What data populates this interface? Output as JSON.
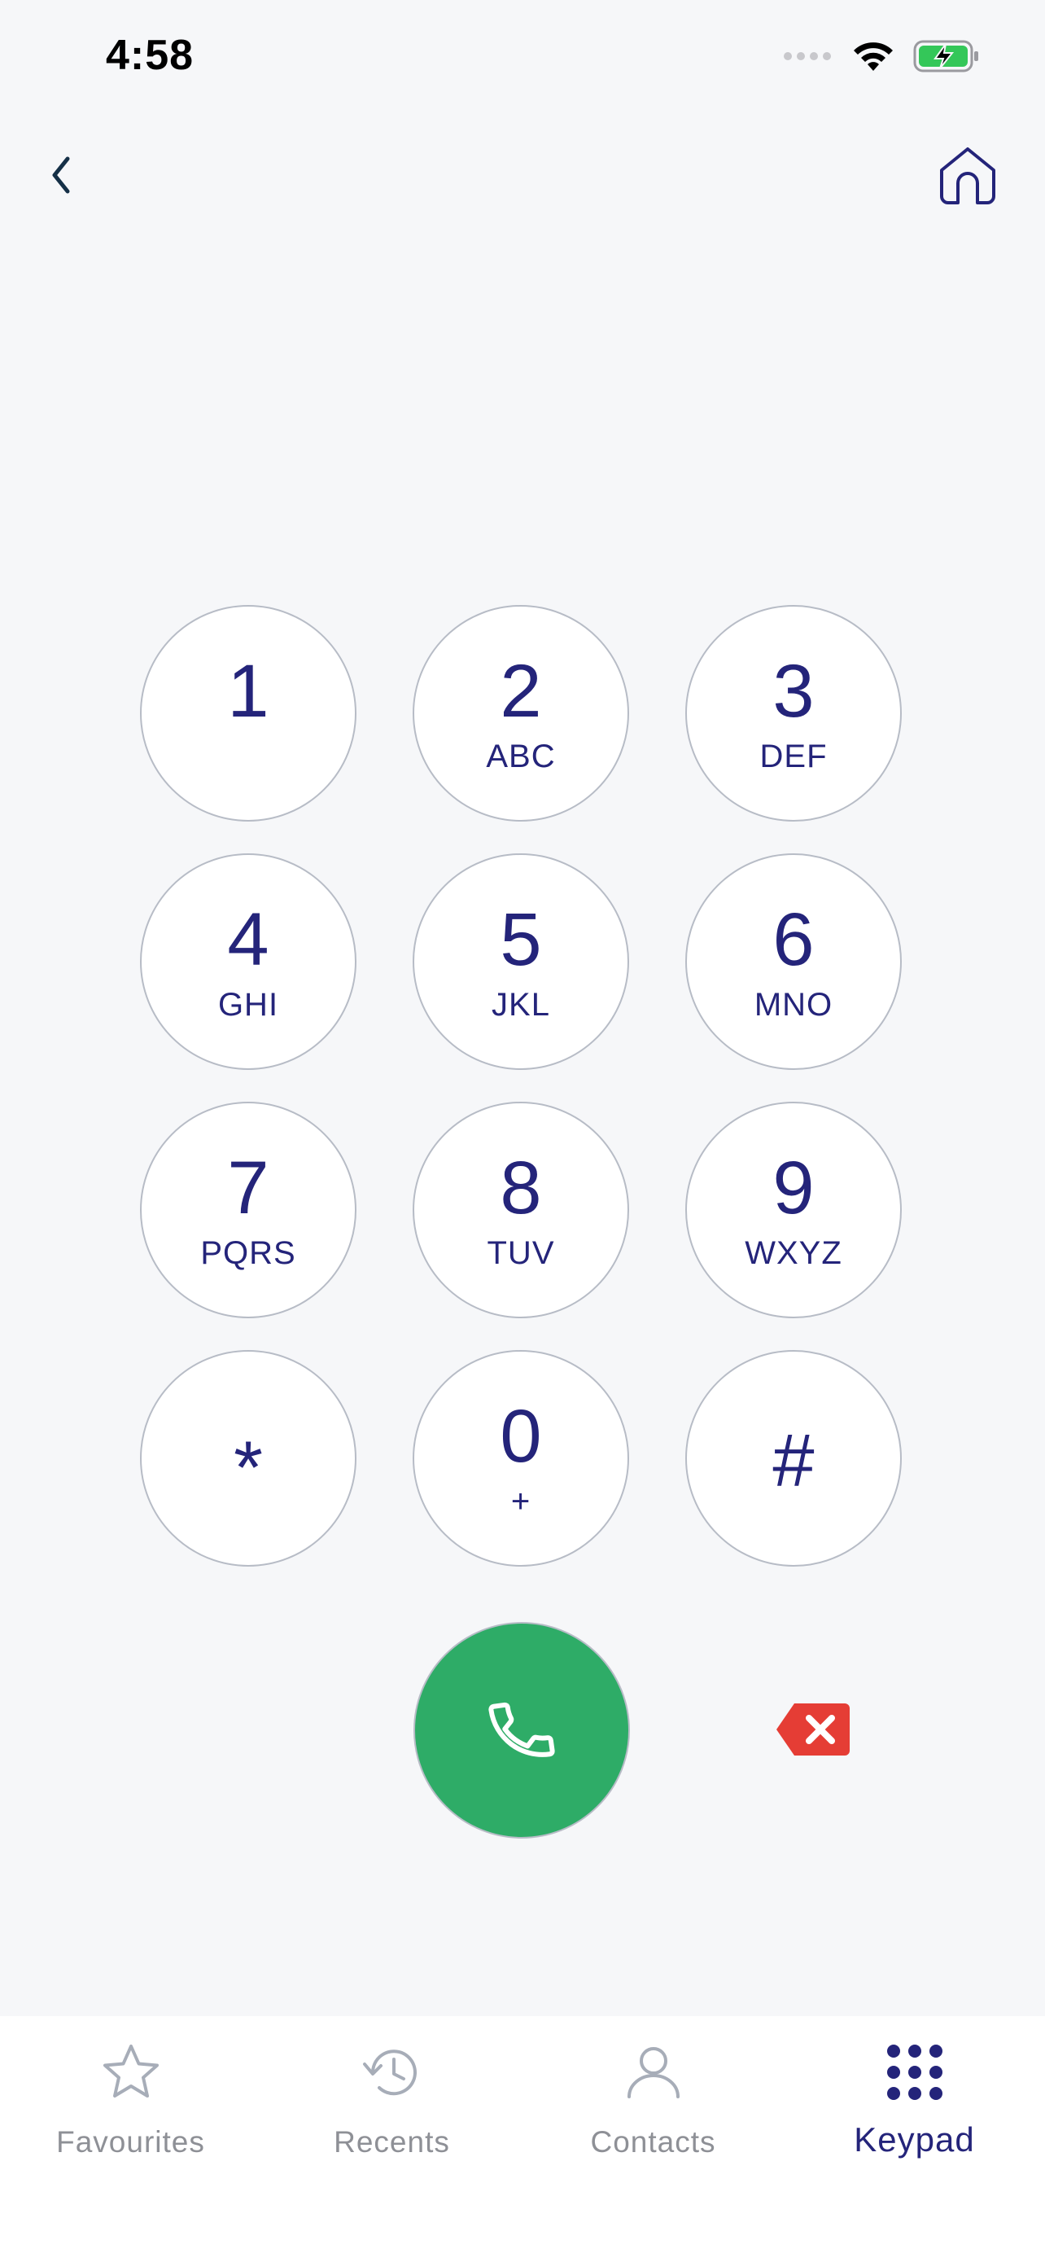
{
  "status_bar": {
    "time": "4:58"
  },
  "keypad": {
    "keys": [
      {
        "digit": "1",
        "letters": ""
      },
      {
        "digit": "2",
        "letters": "ABC"
      },
      {
        "digit": "3",
        "letters": "DEF"
      },
      {
        "digit": "4",
        "letters": "GHI"
      },
      {
        "digit": "5",
        "letters": "JKL"
      },
      {
        "digit": "6",
        "letters": "MNO"
      },
      {
        "digit": "7",
        "letters": "PQRS"
      },
      {
        "digit": "8",
        "letters": "TUV"
      },
      {
        "digit": "9",
        "letters": "WXYZ"
      },
      {
        "digit": "*",
        "letters": ""
      },
      {
        "digit": "0",
        "letters": "+"
      },
      {
        "digit": "#",
        "letters": ""
      }
    ]
  },
  "tabs": [
    {
      "label": "Favourites",
      "icon": "star-icon"
    },
    {
      "label": "Recents",
      "icon": "history-icon"
    },
    {
      "label": "Contacts",
      "icon": "person-icon"
    },
    {
      "label": "Keypad",
      "icon": "keypad-icon",
      "active": true
    }
  ],
  "colors": {
    "accent": "#24247a",
    "call": "#2eac67",
    "delete": "#e53d35",
    "background": "#f6f7f9",
    "inactive": "#8e9096"
  }
}
